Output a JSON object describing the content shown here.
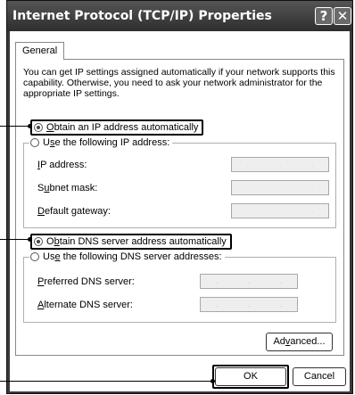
{
  "window": {
    "title": "Internet Protocol (TCP/IP) Properties",
    "help_glyph": "?",
    "close_glyph": "✕"
  },
  "tabs": [
    {
      "label": "General"
    }
  ],
  "description": "You can get IP settings assigned automatically if your network supports this capability. Otherwise, you need to ask your network administrator for the appropriate IP settings.",
  "ip": {
    "auto_pre": "",
    "auto_ul": "O",
    "auto_post": "btain an IP address automatically",
    "manual_pre": "U",
    "manual_ul": "s",
    "manual_post": "e the following IP address:",
    "auto_selected": true,
    "fields": [
      {
        "pre": "",
        "ul": "I",
        "post": "P address:"
      },
      {
        "pre": "S",
        "ul": "u",
        "post": "bnet mask:"
      },
      {
        "pre": "",
        "ul": "D",
        "post": "efault gateway:"
      }
    ]
  },
  "dns": {
    "auto_pre": "O",
    "auto_ul": "b",
    "auto_post": "tain DNS server address automatically",
    "manual_pre": "Us",
    "manual_ul": "e",
    "manual_post": " the following DNS server addresses:",
    "auto_selected": true,
    "fields": [
      {
        "pre": "",
        "ul": "P",
        "post": "referred DNS server:"
      },
      {
        "pre": "",
        "ul": "A",
        "post": "lternate DNS server:"
      }
    ]
  },
  "buttons": {
    "advanced_pre": "Ad",
    "advanced_ul": "v",
    "advanced_post": "anced...",
    "ok": "OK",
    "cancel": "Cancel"
  }
}
